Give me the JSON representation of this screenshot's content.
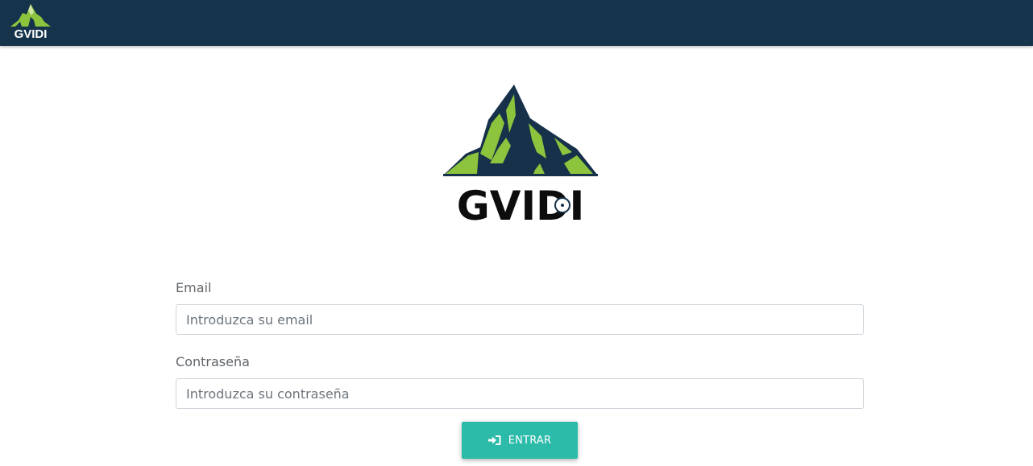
{
  "brand": {
    "name": "GVIDI"
  },
  "colors": {
    "nav_bg": "#15334b",
    "accent": "#2cbaa9",
    "logo_green": "#8cc43e",
    "logo_navy": "#163149"
  },
  "form": {
    "email_label": "Email",
    "email_placeholder": "Introduzca su email",
    "email_value": "",
    "password_label": "Contraseña",
    "password_placeholder": "Introduzca su contraseña",
    "password_value": ""
  },
  "submit": {
    "label": "ENTRAR",
    "icon": "sign-in-icon"
  }
}
